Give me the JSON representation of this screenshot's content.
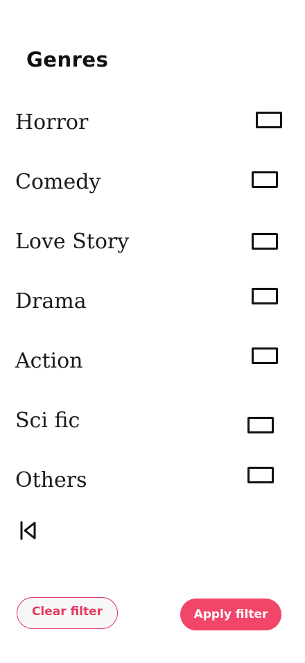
{
  "header": {
    "title": "Genres"
  },
  "genres": [
    {
      "label": "Horror",
      "checked": false
    },
    {
      "label": "Comedy",
      "checked": false
    },
    {
      "label": "Love Story",
      "checked": false
    },
    {
      "label": "Drama",
      "checked": false
    },
    {
      "label": "Action",
      "checked": false
    },
    {
      "label": "Sci fic",
      "checked": false
    },
    {
      "label": "Others",
      "checked": false
    }
  ],
  "icons": {
    "back": "skip-back-icon"
  },
  "actions": {
    "clear_label": "Clear filter",
    "apply_label": "Apply filter"
  },
  "colors": {
    "accent": "#f2456a",
    "accent_border": "#e23a5e"
  }
}
